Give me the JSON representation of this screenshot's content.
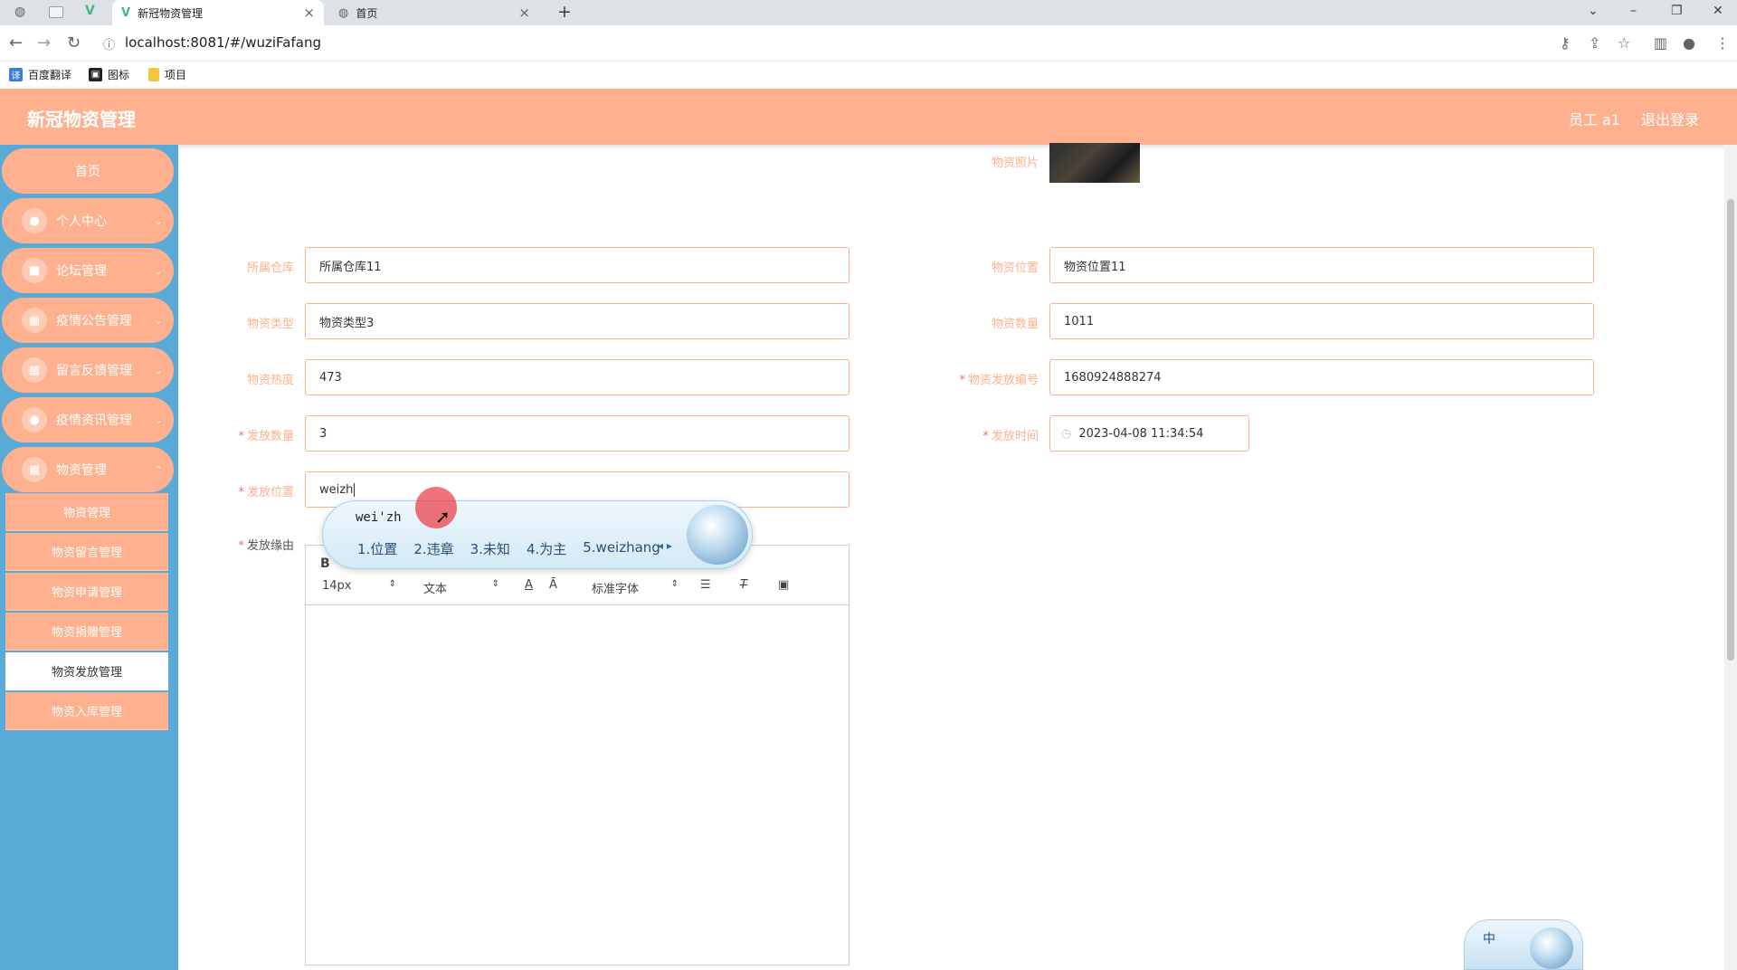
{
  "browser": {
    "tabs": [
      {
        "title": "新冠物资管理",
        "active": true
      },
      {
        "title": "首页",
        "active": false
      }
    ],
    "new_tab": "+",
    "url": "localhost:8081/#/wuziFafang",
    "bookmarks": [
      {
        "label": "百度翻译",
        "icon": "translate-icon",
        "color": "#3b7ddd"
      },
      {
        "label": "图标",
        "icon": "image-icon",
        "color": "#222222"
      },
      {
        "label": "项目",
        "icon": "folder-icon",
        "color": "#f5c542"
      }
    ]
  },
  "header": {
    "title": "新冠物资管理",
    "user": "员工 a1",
    "logout": "退出登录",
    "color": "#ffb08e"
  },
  "sidebar": {
    "color": "#5aaad8",
    "home": "首页",
    "menus": [
      {
        "label": "个人中心",
        "icon": "user-icon"
      },
      {
        "label": "论坛管理",
        "icon": "briefcase-icon"
      },
      {
        "label": "疫情公告管理",
        "icon": "grid-icon"
      },
      {
        "label": "留言反馈管理",
        "icon": "grid-icon"
      },
      {
        "label": "疫情资讯管理",
        "icon": "user-icon"
      },
      {
        "label": "物资管理",
        "icon": "grid-icon"
      }
    ],
    "submenu": [
      "物资管理",
      "物资留言管理",
      "物资申请管理",
      "物资捐赠管理",
      "物资发放管理",
      "物资入库管理"
    ],
    "active_submenu": "物资发放管理"
  },
  "form": {
    "photo_label": "物资照片",
    "warehouse_label": "所属仓库",
    "warehouse_value": "所属仓库11",
    "location_label": "物资位置",
    "location_value": "物资位置11",
    "type_label": "物资类型",
    "type_value": "物资类型3",
    "qty_label": "物资数量",
    "qty_value": "1011",
    "heat_label": "物资热度",
    "heat_value": "473",
    "dist_no_label": "物资发放编号",
    "dist_no_value": "1680924888274",
    "dist_qty_label": "发放数量",
    "dist_qty_value": "3",
    "dist_time_label": "发放时间",
    "dist_time_value": "2023-04-08 11:34:54",
    "dist_loc_label": "发放位置",
    "dist_loc_value": "weizh",
    "reason_label": "发放缘由",
    "required_mark": "*"
  },
  "editor": {
    "bold": "B",
    "font_size": "14px",
    "header_type": "文本",
    "font_family": "标准字体"
  },
  "ime": {
    "composition": "wei'zh",
    "candidates": [
      "1.位置",
      "2.违章",
      "3.未知",
      "4.为主",
      "5.weizhang"
    ],
    "status": "中"
  }
}
